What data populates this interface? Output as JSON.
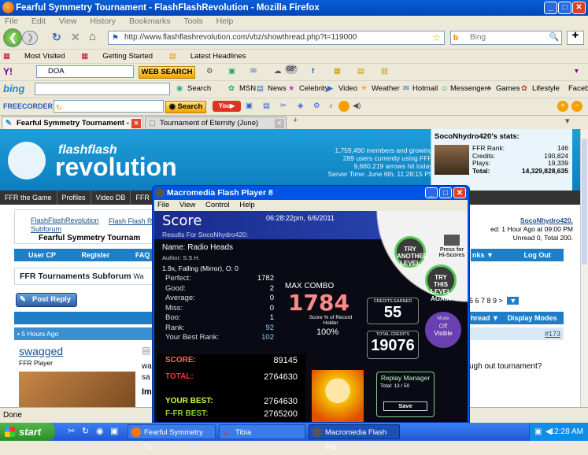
{
  "window": {
    "title": "Fearful Symmetry Tournament - FlashFlashRevolution - Mozilla Firefox"
  },
  "menu": [
    "File",
    "Edit",
    "View",
    "History",
    "Bookmarks",
    "Tools",
    "Help"
  ],
  "nav": {
    "url": "http://www.flashflashrevolution.com/vbz/showthread.php?t=119000",
    "search_placeholder": "Bing"
  },
  "bookmarks": [
    "Most Visited",
    "Getting Started",
    "Latest Headlines"
  ],
  "yahoo": {
    "logo": "Y!",
    "search_value": "DOA",
    "web_search": "WEB SEARCH",
    "temp": "68°"
  },
  "bing_bar": {
    "logo": "bing",
    "items": [
      "Search",
      "MSN",
      "News",
      "Celebrity",
      "Video",
      "Weather",
      "Hotmail",
      "Messenger",
      "Games",
      "Lifestyle",
      "Faceb"
    ]
  },
  "freecorder": {
    "logo": "FREECORDER",
    "search": "Search"
  },
  "tabs": [
    {
      "label": "Fearful Symmetry Tournament - ..."
    },
    {
      "label": "Tournament of Eternity (June)"
    }
  ],
  "site": {
    "logo_top": "flashflash",
    "logo_bottom": "revolution",
    "info": [
      "1,759,490 members and growing!",
      "289 users currently using FFR.",
      "9,660,219 arrows hit today!",
      "Server Time: June 6th, 11:28:15 PM"
    ],
    "stats_title": "SocoNhydro420's stats:",
    "stats": [
      {
        "k": "FFR Rank:",
        "v": "146"
      },
      {
        "k": "Credits:",
        "v": "190,824"
      },
      {
        "k": "Plays:",
        "v": "19,339"
      },
      {
        "k": "Total:",
        "v": "14,329,828,635"
      }
    ],
    "navlinks": [
      "FFR the Game",
      "Profiles",
      "Video DB",
      "FFR For"
    ],
    "breadcrumb1": "FlashFlashRevolution",
    "breadcrumb2": "Flash Flash R",
    "breadcrumb3": "Subforum",
    "thread_title": "Fearful Symmetry Tournam",
    "user_right": "SocoNhydro420.",
    "user_right2": "ed: 1 Hour Ago at 09:00 PM",
    "user_right3": "Unread 0, Total 200.",
    "bar_links": [
      "User CP",
      "Register",
      "FAQ"
    ],
    "bar_right": [
      "nks ▼",
      "Log Out"
    ],
    "forum_title": "FFR Tournaments Subforum",
    "forum_title_tail": "Wa",
    "post_reply": "Post Reply",
    "pages": "5 6 7 8 9 >",
    "thread_tools": [
      "hread ▼",
      "Display Modes ▼"
    ],
    "post_time": "5 Hours Ago",
    "post_num": "#173",
    "username": "swagged",
    "usertitle": "FFR Player",
    "post_text": "ugh out tournament?",
    "snippet1": "wa",
    "snippet2": "sa",
    "snippet3": "Im"
  },
  "status": "Done",
  "taskbar": {
    "start": "start",
    "buttons": [
      "Fearful Symmetry To...",
      "Tibia",
      "Macromedia Flash Pla..."
    ],
    "clock": "12:28 AM"
  },
  "flash": {
    "title": "Macromedia Flash Player 8",
    "menu": [
      "File",
      "View",
      "Control",
      "Help"
    ],
    "score_title": "Score",
    "datetime": "06:28:22pm, 6/6/2011",
    "results_for": "Results For SocoNhydro420:",
    "song_name": "Name: Radio Heads",
    "author": "Author: S.S.H.",
    "mods": "1.9x, Falling (Mirror), O: 0",
    "judgements": [
      {
        "k": "Perfect:",
        "v": "1782"
      },
      {
        "k": "Good:",
        "v": "2"
      },
      {
        "k": "Average:",
        "v": "0"
      },
      {
        "k": "Miss:",
        "v": "0"
      },
      {
        "k": "Boo:",
        "v": "1"
      },
      {
        "k": "Rank:",
        "v": "92"
      },
      {
        "k": "Your Best Rank:",
        "v": "102"
      }
    ],
    "max_combo_label": "MAX COMBO",
    "max_combo": "1784",
    "record_label": "Score % of Record Holder",
    "record_pct": "100%",
    "credits_label": "CREDITS EARNED",
    "credits": "55",
    "total_credits_label": "TOTAL CREDITS",
    "total_credits": "19076",
    "score_label": "SCORE:",
    "score": "89145",
    "total_label": "TOTAL:",
    "total": "2764630",
    "your_best_label": "YOUR BEST:",
    "your_best": "2764630",
    "ffr_best_label": "F-FR BEST:",
    "ffr_best": "2765200",
    "try_another": "TRY ANOTHER LEVEL",
    "try_again": "TRY THIS LEVEL AGAIN",
    "press_for": "Press for Hi-Scores",
    "mode_label": "Mode",
    "mode_off": "Off",
    "mode_visible": "Visible",
    "replay_title": "Replay Manager",
    "replay_total": "Total: 13 / 50",
    "replay_save": "Save"
  }
}
